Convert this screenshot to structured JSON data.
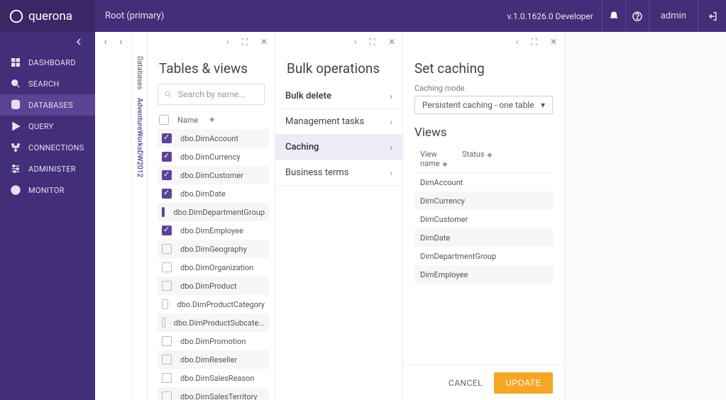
{
  "brand": "querona",
  "breadcrumb": "Root (primary)",
  "version": "v.1.0.1626.0 Developer",
  "user": "admin",
  "sidebar": {
    "items": [
      {
        "label": "DASHBOARD"
      },
      {
        "label": "SEARCH"
      },
      {
        "label": "DATABASES"
      },
      {
        "label": "QUERY"
      },
      {
        "label": "CONNECTIONS"
      },
      {
        "label": "ADMINISTER"
      },
      {
        "label": "MONITOR"
      }
    ]
  },
  "vtabs": {
    "items": [
      {
        "label": "Databases"
      },
      {
        "label": "AdventureWorksDW2012"
      }
    ]
  },
  "tables": {
    "title": "Tables & views",
    "search_placeholder": "Search by name...",
    "header_name": "Name",
    "rows": [
      {
        "name": "dbo.DimAccount",
        "checked": true
      },
      {
        "name": "dbo.DimCurrency",
        "checked": true
      },
      {
        "name": "dbo.DimCustomer",
        "checked": true
      },
      {
        "name": "dbo.DimDate",
        "checked": true
      },
      {
        "name": "dbo.DimDepartmentGroup",
        "checked": true
      },
      {
        "name": "dbo.DimEmployee",
        "checked": true
      },
      {
        "name": "dbo.DimGeography",
        "checked": false
      },
      {
        "name": "dbo.DimOrganization",
        "checked": false
      },
      {
        "name": "dbo.DimProduct",
        "checked": false
      },
      {
        "name": "dbo.DimProductCategory",
        "checked": false
      },
      {
        "name": "dbo.DimProductSubcate...",
        "checked": false
      },
      {
        "name": "dbo.DimPromotion",
        "checked": false
      },
      {
        "name": "dbo.DimReseller",
        "checked": false
      },
      {
        "name": "dbo.DimSalesReason",
        "checked": false
      },
      {
        "name": "dbo.DimSalesTerritory",
        "checked": false
      }
    ]
  },
  "bulk": {
    "title": "Bulk operations",
    "items": [
      {
        "label": "Bulk delete",
        "active": false,
        "bold": true
      },
      {
        "label": "Management tasks",
        "active": false
      },
      {
        "label": "Caching",
        "active": true
      },
      {
        "label": "Business terms",
        "active": false
      }
    ]
  },
  "caching": {
    "title": "Set caching",
    "mode_label": "Caching mode",
    "mode_value": "Persistent caching - one table",
    "views_title": "Views",
    "header_viewname": "View name",
    "header_status": "Status",
    "rows": [
      {
        "name": "DimAccount"
      },
      {
        "name": "DimCurrency"
      },
      {
        "name": "DimCustomer"
      },
      {
        "name": "DimDate"
      },
      {
        "name": "DimDepartmentGroup"
      },
      {
        "name": "DimEmployee"
      }
    ],
    "cancel": "CANCEL",
    "update": "UPDATE"
  }
}
